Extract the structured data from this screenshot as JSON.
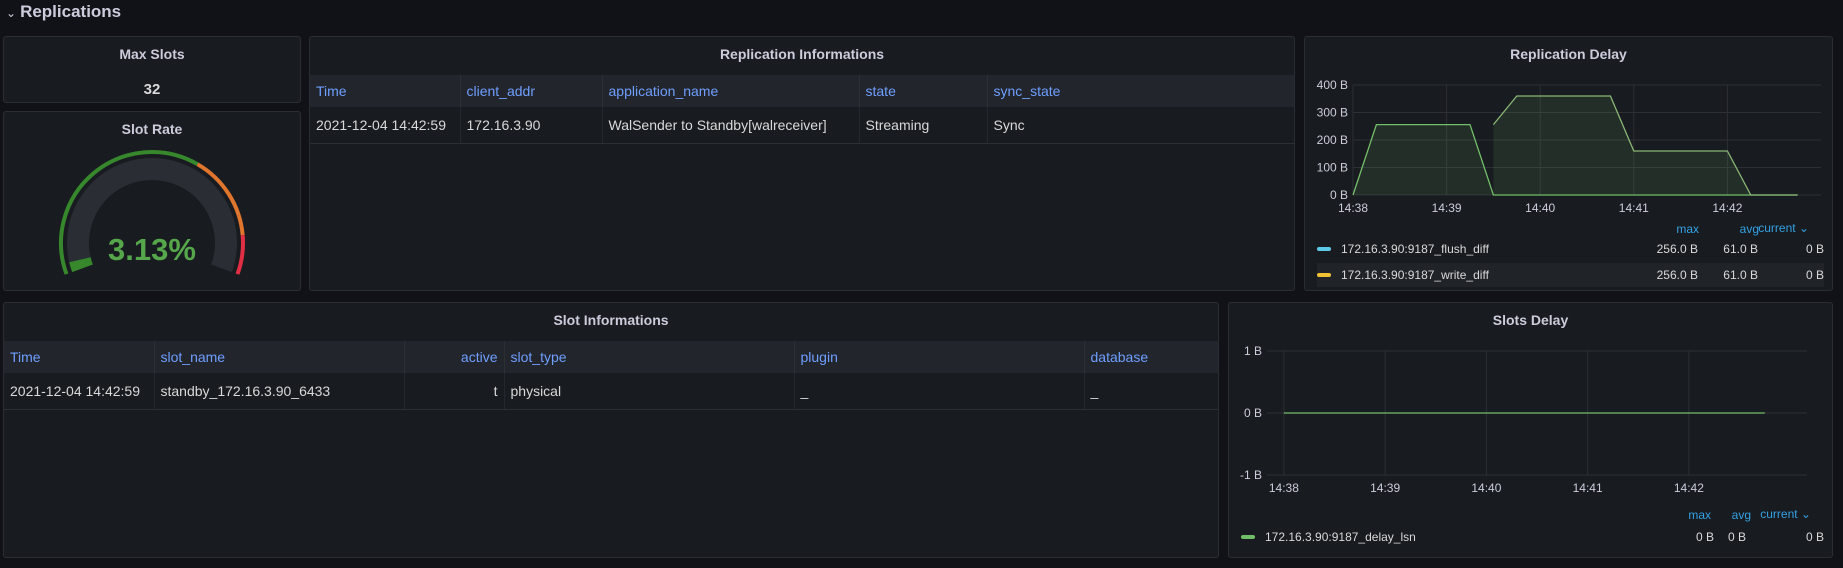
{
  "row": {
    "chevron": "⌄",
    "title": "Replications"
  },
  "max_slots": {
    "title": "Max Slots",
    "value": "32"
  },
  "slot_rate": {
    "title": "Slot Rate",
    "value_text": "3.13%",
    "value_percent": 3.13,
    "colors": {
      "green": "#37872d",
      "orange": "#e0752d",
      "red": "#e02f44",
      "text": "#56a64b"
    }
  },
  "replication_info": {
    "title": "Replication Informations",
    "columns": [
      "Time",
      "client_addr",
      "application_name",
      "state",
      "sync_state"
    ],
    "rows": [
      [
        "2021-12-04 14:42:59",
        "172.16.3.90",
        "WalSender to Standby[walreceiver]",
        "Streaming",
        "Sync"
      ]
    ]
  },
  "replication_delay": {
    "title": "Replication Delay",
    "legend_headers": {
      "max": "max",
      "avg": "avg",
      "current": "current ⌄"
    },
    "legend": [
      {
        "name": "172.16.3.90:9187_flush_diff",
        "color": "#73bf69",
        "swatch": "#5fc9e8",
        "max": "256.0 B",
        "avg": "61.0 B",
        "current": "0 B"
      },
      {
        "name": "172.16.3.90:9187_write_diff",
        "color": "#8ab776",
        "swatch": "#f2c232",
        "max": "256.0 B",
        "avg": "61.0 B",
        "current": "0 B"
      }
    ]
  },
  "slot_info": {
    "title": "Slot Informations",
    "columns": [
      "Time",
      "slot_name",
      "active",
      "slot_type",
      "plugin",
      "database"
    ],
    "rows": [
      [
        "2021-12-04 14:42:59",
        "standby_172.16.3.90_6433",
        "t",
        "physical",
        "_",
        "_"
      ]
    ]
  },
  "slots_delay": {
    "title": "Slots Delay",
    "legend_headers": {
      "max": "max",
      "avg": "avg",
      "current": "current ⌄"
    },
    "legend": [
      {
        "name": "172.16.3.90:9187_delay_lsn",
        "color": "#73bf69",
        "max": "0 B",
        "avg": "0 B",
        "current": "0 B"
      }
    ]
  },
  "chart_data": [
    {
      "type": "area",
      "title": "Replication Delay",
      "x_ticks": [
        "14:38",
        "14:39",
        "14:40",
        "14:41",
        "14:42"
      ],
      "y_ticks": [
        "0 B",
        "100 B",
        "200 B",
        "300 B",
        "400 B"
      ],
      "ylim": [
        0,
        400
      ],
      "xlim": [
        "14:38",
        "14:43"
      ],
      "grid": true,
      "legend_position": "bottom",
      "series": [
        {
          "name": "172.16.3.90:9187_flush_diff",
          "x": [
            "14:38:00",
            "14:38:15",
            "14:39:15",
            "14:39:30",
            "14:42:45"
          ],
          "values": [
            0,
            256,
            256,
            0,
            0
          ]
        },
        {
          "name": "172.16.3.90:9187_write_diff",
          "x": [
            "14:39:30",
            "14:39:45",
            "14:40:45",
            "14:41:00",
            "14:42:00",
            "14:42:15",
            "14:42:45"
          ],
          "values": [
            256,
            360,
            360,
            160,
            160,
            0,
            0
          ]
        }
      ]
    },
    {
      "type": "line",
      "title": "Slots Delay",
      "x_ticks": [
        "14:38",
        "14:39",
        "14:40",
        "14:41",
        "14:42"
      ],
      "y_ticks": [
        "-1 B",
        "0 B",
        "1 B"
      ],
      "ylim": [
        -1,
        1
      ],
      "grid": true,
      "legend_position": "bottom",
      "series": [
        {
          "name": "172.16.3.90:9187_delay_lsn",
          "x": [
            "14:38:00",
            "14:42:45"
          ],
          "values": [
            0,
            0
          ]
        }
      ]
    }
  ]
}
